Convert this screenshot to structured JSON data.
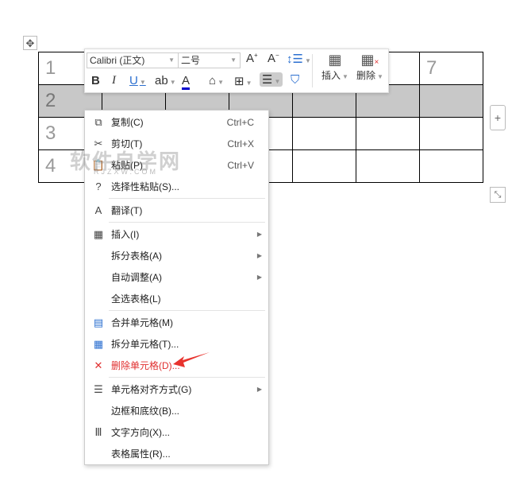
{
  "table": {
    "rows": [
      [
        "1",
        "",
        "",
        "",
        "",
        "",
        "7"
      ],
      [
        "2",
        "",
        "",
        "",
        "",
        "",
        ""
      ],
      [
        "3",
        "",
        "",
        "",
        "",
        "",
        ""
      ],
      [
        "4",
        "",
        "",
        "",
        "",
        "",
        ""
      ]
    ]
  },
  "toolbar": {
    "font": "Calibri (正文)",
    "size": "二号",
    "insert": "插入",
    "delete": "删除",
    "bold": "B",
    "italic": "I",
    "underline": "U"
  },
  "menu": {
    "items": [
      {
        "label": "复制(C)",
        "shortcut": "Ctrl+C",
        "icon": "⧉"
      },
      {
        "label": "剪切(T)",
        "shortcut": "Ctrl+X",
        "icon": "✂"
      },
      {
        "label": "粘贴(P)",
        "shortcut": "Ctrl+V",
        "icon": "📋"
      },
      {
        "label": "选择性粘贴(S)...",
        "icon": "?"
      },
      {
        "label": "翻译(T)",
        "icon": "A"
      },
      {
        "label": "插入(I)",
        "icon": "▦"
      },
      {
        "label": "拆分表格(A)"
      },
      {
        "label": "自动调整(A)"
      },
      {
        "label": "全选表格(L)"
      },
      {
        "label": "合并单元格(M)",
        "icon": "▤"
      },
      {
        "label": "拆分单元格(T)...",
        "icon": "▦"
      },
      {
        "label": "删除单元格(D)...",
        "icon": "✕"
      },
      {
        "label": "单元格对齐方式(G)",
        "icon": "☰"
      },
      {
        "label": "边框和底纹(B)..."
      },
      {
        "label": "文字方向(X)...",
        "icon": "Ⅲ"
      },
      {
        "label": "表格属性(R)..."
      }
    ]
  },
  "watermark": {
    "text": "软件自学网",
    "url": "RJZXW.COM"
  },
  "colors": {
    "selected_row": "#c8c8c8",
    "delete_text": "#e03030"
  }
}
